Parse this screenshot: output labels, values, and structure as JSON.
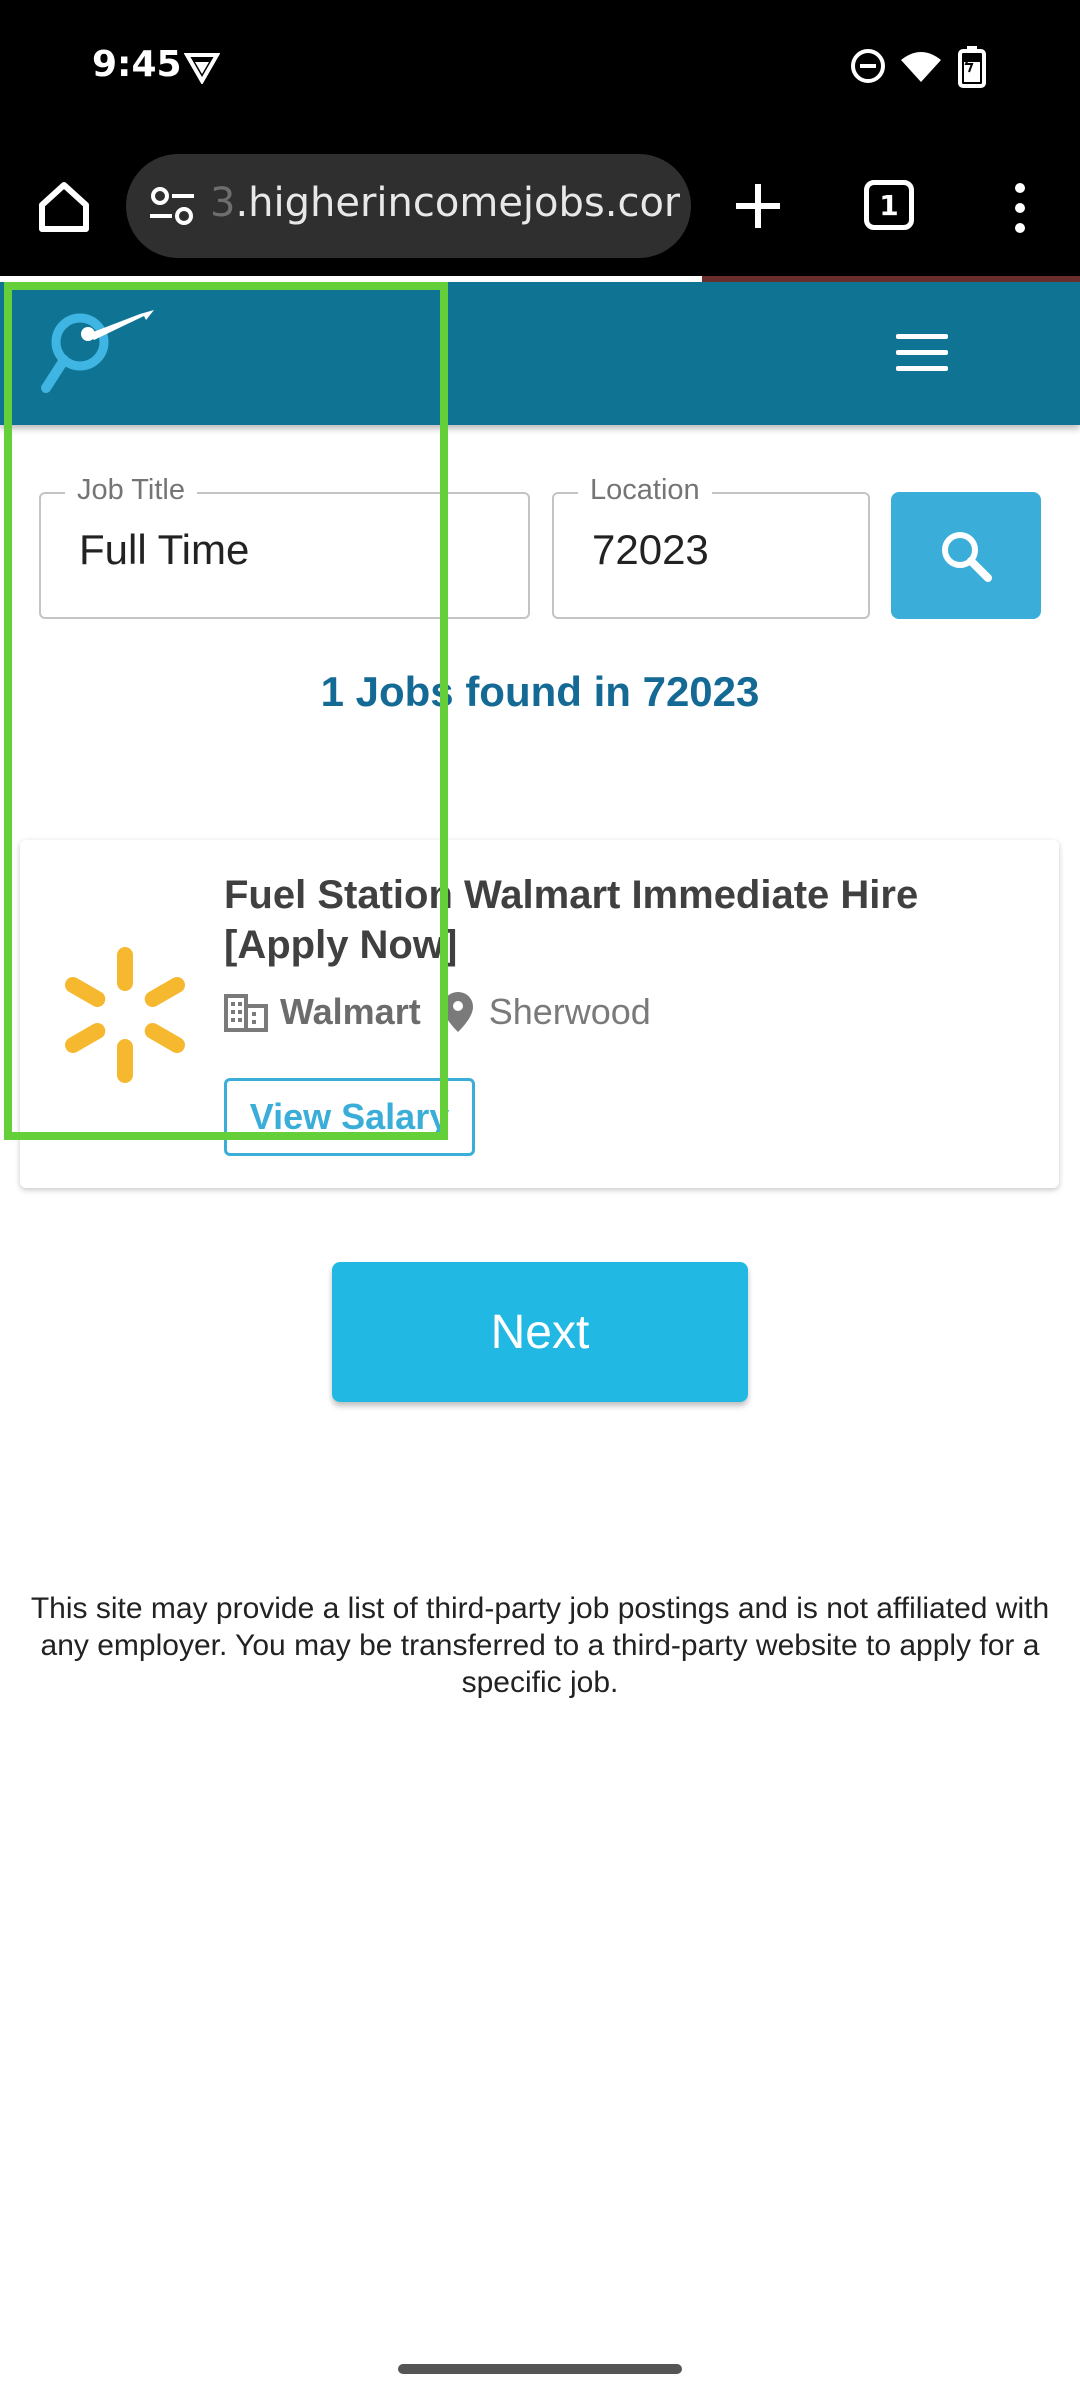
{
  "status_bar": {
    "time": "9:45"
  },
  "browser": {
    "url_prefix": "3",
    "url_main": ".higherincomejobs.com",
    "tab_count": "1",
    "page_load_progress": 0.65
  },
  "search": {
    "job_title_label": "Job Title",
    "job_title_value": "Full Time",
    "location_label": "Location",
    "location_value": "72023"
  },
  "results": {
    "count_text": "1 Jobs found in 72023"
  },
  "jobs": [
    {
      "title": "Fuel Station Walmart Immediate Hire [Apply Now]",
      "company": "Walmart",
      "location": "Sherwood",
      "salary_button": "View Salary"
    }
  ],
  "pagination": {
    "next_label": "Next"
  },
  "footer": {
    "disclaimer": "This site may provide a list of third-party job postings and is not affiliated with any employer. You may be transferred to a third-party website to apply for a specific job."
  },
  "colors": {
    "header": "#0f7394",
    "accent": "#3aaed8",
    "next_button": "#22b8e4",
    "results_text": "#156a95",
    "highlight": "#65cf3a",
    "walmart_spark": "#f5b82e"
  },
  "icons": [
    "home-icon",
    "tune-icon",
    "plus-icon",
    "tabs-icon",
    "more-vert-icon",
    "hamburger-icon",
    "search-icon",
    "building-icon",
    "location-pin-icon",
    "walmart-spark-icon",
    "dnd-icon",
    "wifi-icon",
    "battery-icon",
    "vpn-icon"
  ]
}
